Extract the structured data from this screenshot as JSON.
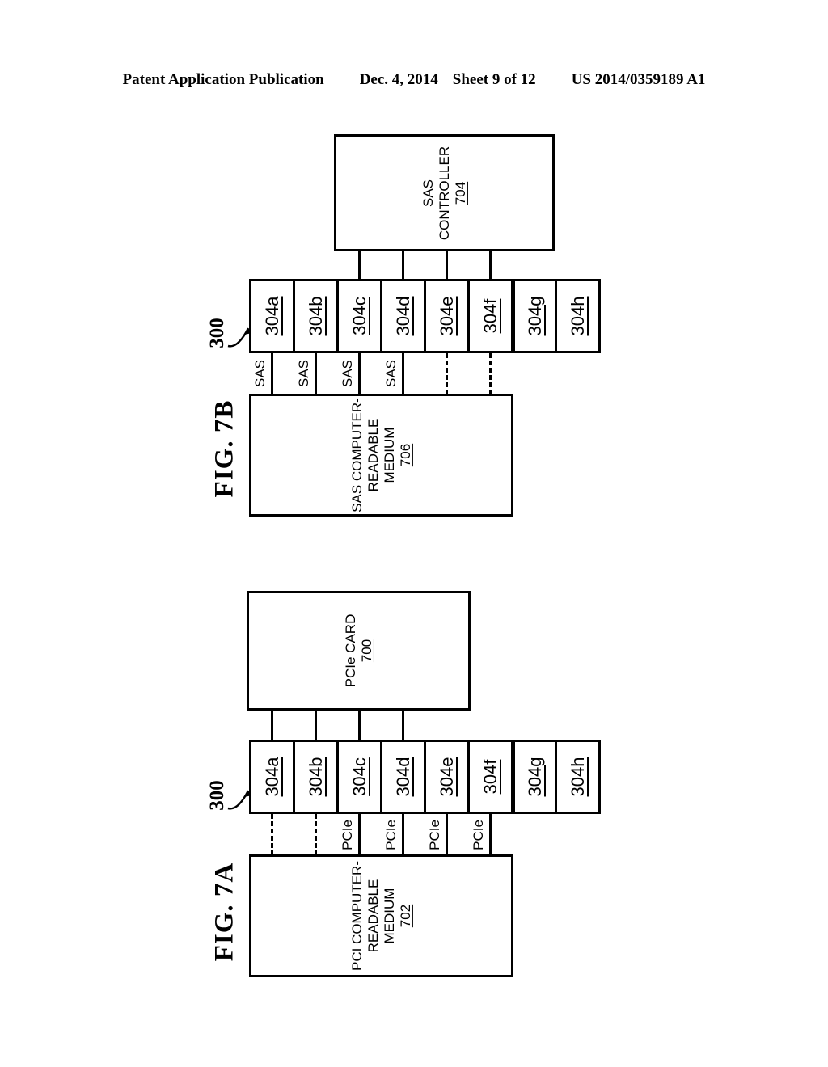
{
  "header": {
    "publication": "Patent Application Publication",
    "date": "Dec. 4, 2014",
    "sheet": "Sheet 9 of 12",
    "patent_number": "US 2014/0359189 A1"
  },
  "figures": [
    {
      "id": "fig-7b",
      "caption": "FIG. 7B",
      "device_reference": "300",
      "top_box": {
        "line1": "SAS",
        "line2": "CONTROLLER",
        "number": "704"
      },
      "bottom_box": {
        "line1": "SAS COMPUTER-",
        "line2": "READABLE",
        "line3": "MEDIUM",
        "number": "706"
      },
      "ports": [
        {
          "label": "304a",
          "top_link": true,
          "bottom_link": "SAS"
        },
        {
          "label": "304b",
          "top_link": true,
          "bottom_link": "SAS"
        },
        {
          "label": "304c",
          "top_link": true,
          "bottom_link": "SAS"
        },
        {
          "label": "304d",
          "top_link": true,
          "bottom_link": "SAS"
        },
        {
          "label": "304e",
          "top_link": false,
          "bottom_link": "dashed"
        },
        {
          "label": "304f",
          "top_link": false,
          "bottom_link": "dashed"
        },
        {
          "label": "304g",
          "top_link": false,
          "bottom_link": "none"
        },
        {
          "label": "304h",
          "top_link": false,
          "bottom_link": "none"
        }
      ]
    },
    {
      "id": "fig-7a",
      "caption": "FIG. 7A",
      "device_reference": "300",
      "top_box": {
        "line1": "PCIe CARD",
        "number": "700"
      },
      "bottom_box": {
        "line1": "PCI COMPUTER-",
        "line2": "READABLE",
        "line3": "MEDIUM",
        "number": "702"
      },
      "ports": [
        {
          "label": "304a",
          "top_link": true,
          "bottom_link": "dashed"
        },
        {
          "label": "304b",
          "top_link": true,
          "bottom_link": "dashed"
        },
        {
          "label": "304c",
          "top_link": true,
          "bottom_link": "PCIe"
        },
        {
          "label": "304d",
          "top_link": true,
          "bottom_link": "PCIe"
        },
        {
          "label": "304e",
          "top_link": false,
          "bottom_link": "PCIe"
        },
        {
          "label": "304f",
          "top_link": false,
          "bottom_link": "PCIe"
        },
        {
          "label": "304g",
          "top_link": false,
          "bottom_link": "none"
        },
        {
          "label": "304h",
          "top_link": false,
          "bottom_link": "none"
        }
      ]
    }
  ]
}
